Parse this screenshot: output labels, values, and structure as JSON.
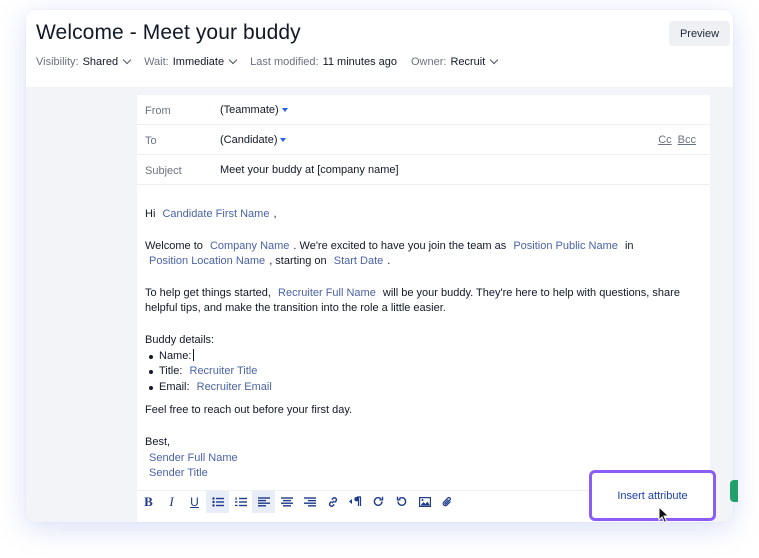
{
  "header": {
    "title": "Welcome - Meet your buddy",
    "preview_label": "Preview",
    "meta": [
      {
        "label": "Visibility:",
        "value": "Shared"
      },
      {
        "label": "Wait:",
        "value": "Immediate"
      },
      {
        "label": "Last modified:",
        "value": "11 minutes ago"
      },
      {
        "label": "Owner:",
        "value": "Recruit"
      }
    ]
  },
  "email": {
    "from_label": "From",
    "from_value": "(Teammate)",
    "to_label": "To",
    "to_value": "(Candidate)",
    "cc_label": "Cc",
    "bcc_label": "Bcc",
    "subject_label": "Subject",
    "subject_value": "Meet your buddy at [company name]"
  },
  "message": {
    "hi": "Hi",
    "candidate_first_name": "Candidate First Name",
    "hi_comma": ",",
    "welcome_to": "Welcome to",
    "company_name": "Company Name",
    "excited": ". We're excited to have you join the team as",
    "position_public_name": "Position Public Name",
    "in": "in",
    "position_location_name": "Position Location Name",
    "starting_on": ", starting on",
    "start_date": "Start Date",
    "period": ".",
    "help_start": "To help get things started,",
    "recruiter_full_name": "Recruiter Full Name",
    "help_rest": "will be your buddy. They're here to help with questions, share helpful tips, and make the transition into the role a little easier.",
    "buddy_details": "Buddy details:",
    "name_label": "Name:",
    "title_label": "Title:",
    "recruiter_title": "Recruiter Title",
    "email_label": "Email:",
    "recruiter_email": "Recruiter Email",
    "feel_free": "Feel free to reach out before your first day.",
    "best": "Best,",
    "sender_full_name": "Sender Full Name",
    "sender_title": "Sender Title"
  },
  "toolbar": {
    "bold": "B",
    "italic": "I",
    "underline": "U",
    "icons": [
      "bold-icon",
      "italic-icon",
      "underline-icon",
      "bullet-list-icon",
      "numbered-list-icon",
      "align-left-icon",
      "align-center-icon",
      "align-right-icon",
      "link-icon",
      "rtl-icon",
      "redo-icon",
      "undo-icon",
      "image-icon",
      "attachment-icon"
    ]
  },
  "insert_attribute_label": "Insert attribute",
  "colors": {
    "accent": "#8b5cf6",
    "token": "#4a63a8",
    "toolbar_icon": "#1e3a8a"
  }
}
